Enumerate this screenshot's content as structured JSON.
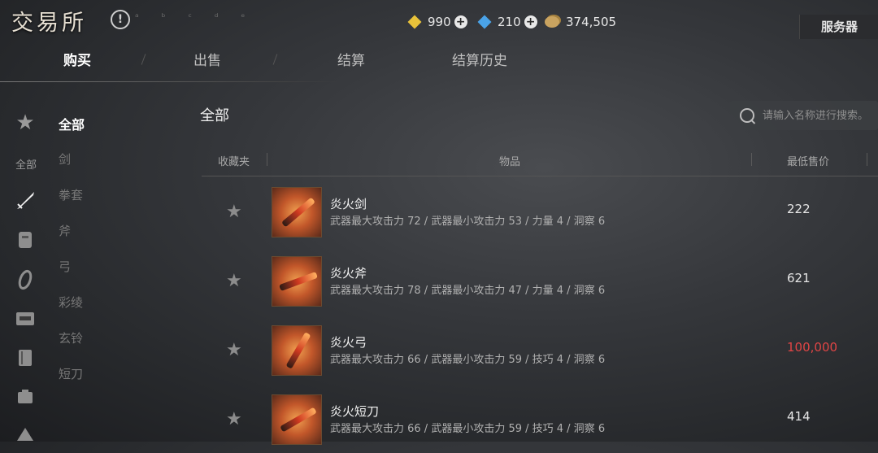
{
  "header": {
    "title": "交易所",
    "faint_text": "ᵃ ᵇ ᶜ ᵈ ᵉ",
    "currencies": [
      {
        "icon": "gold-gem-icon",
        "value": "990",
        "color": "#e8c23a"
      },
      {
        "icon": "blue-gem-icon",
        "value": "210",
        "color": "#4aa3e8"
      },
      {
        "icon": "coin-pile-icon",
        "value": "374,505",
        "color": "#c9a360"
      }
    ],
    "server_label": "服务器"
  },
  "tabs": [
    {
      "label": "购买",
      "active": true
    },
    {
      "label": "出售",
      "active": false
    },
    {
      "label": "结算",
      "active": false
    },
    {
      "label": "结算历史",
      "active": false
    }
  ],
  "sidebar": {
    "icon_label_all": "全部",
    "icons": [
      "star-icon",
      "sword-icon",
      "armor-icon",
      "accessory-icon",
      "chest-icon",
      "book-icon",
      "box-icon",
      "misc-icon"
    ]
  },
  "categories": [
    "全部",
    "剑",
    "拳套",
    "斧",
    "弓",
    "彩绫",
    "玄铃",
    "短刀"
  ],
  "main": {
    "section_title": "全部",
    "search_placeholder": "请输入名称进行搜索。"
  },
  "table": {
    "headers": {
      "favorite": "收藏夹",
      "item": "物品",
      "min_price": "最低售价"
    },
    "rows": [
      {
        "name": "炎火剑",
        "stats": "武器最大攻击力 72  / 武器最小攻击力 53  / 力量 4  / 洞察 6",
        "price": "222",
        "price_color": "#e6e6e6"
      },
      {
        "name": "炎火斧",
        "stats": "武器最大攻击力 78  / 武器最小攻击力 47  / 力量 4  / 洞察 6",
        "price": "621",
        "price_color": "#e6e6e6"
      },
      {
        "name": "炎火弓",
        "stats": "武器最大攻击力 66  / 武器最小攻击力 59  / 技巧 4  / 洞察 6",
        "price": "100,000",
        "price_color": "#e04545"
      },
      {
        "name": "炎火短刀",
        "stats": "武器最大攻击力 66  / 武器最小攻击力 59  / 技巧 4  / 洞察 6",
        "price": "414",
        "price_color": "#e6e6e6"
      }
    ]
  }
}
